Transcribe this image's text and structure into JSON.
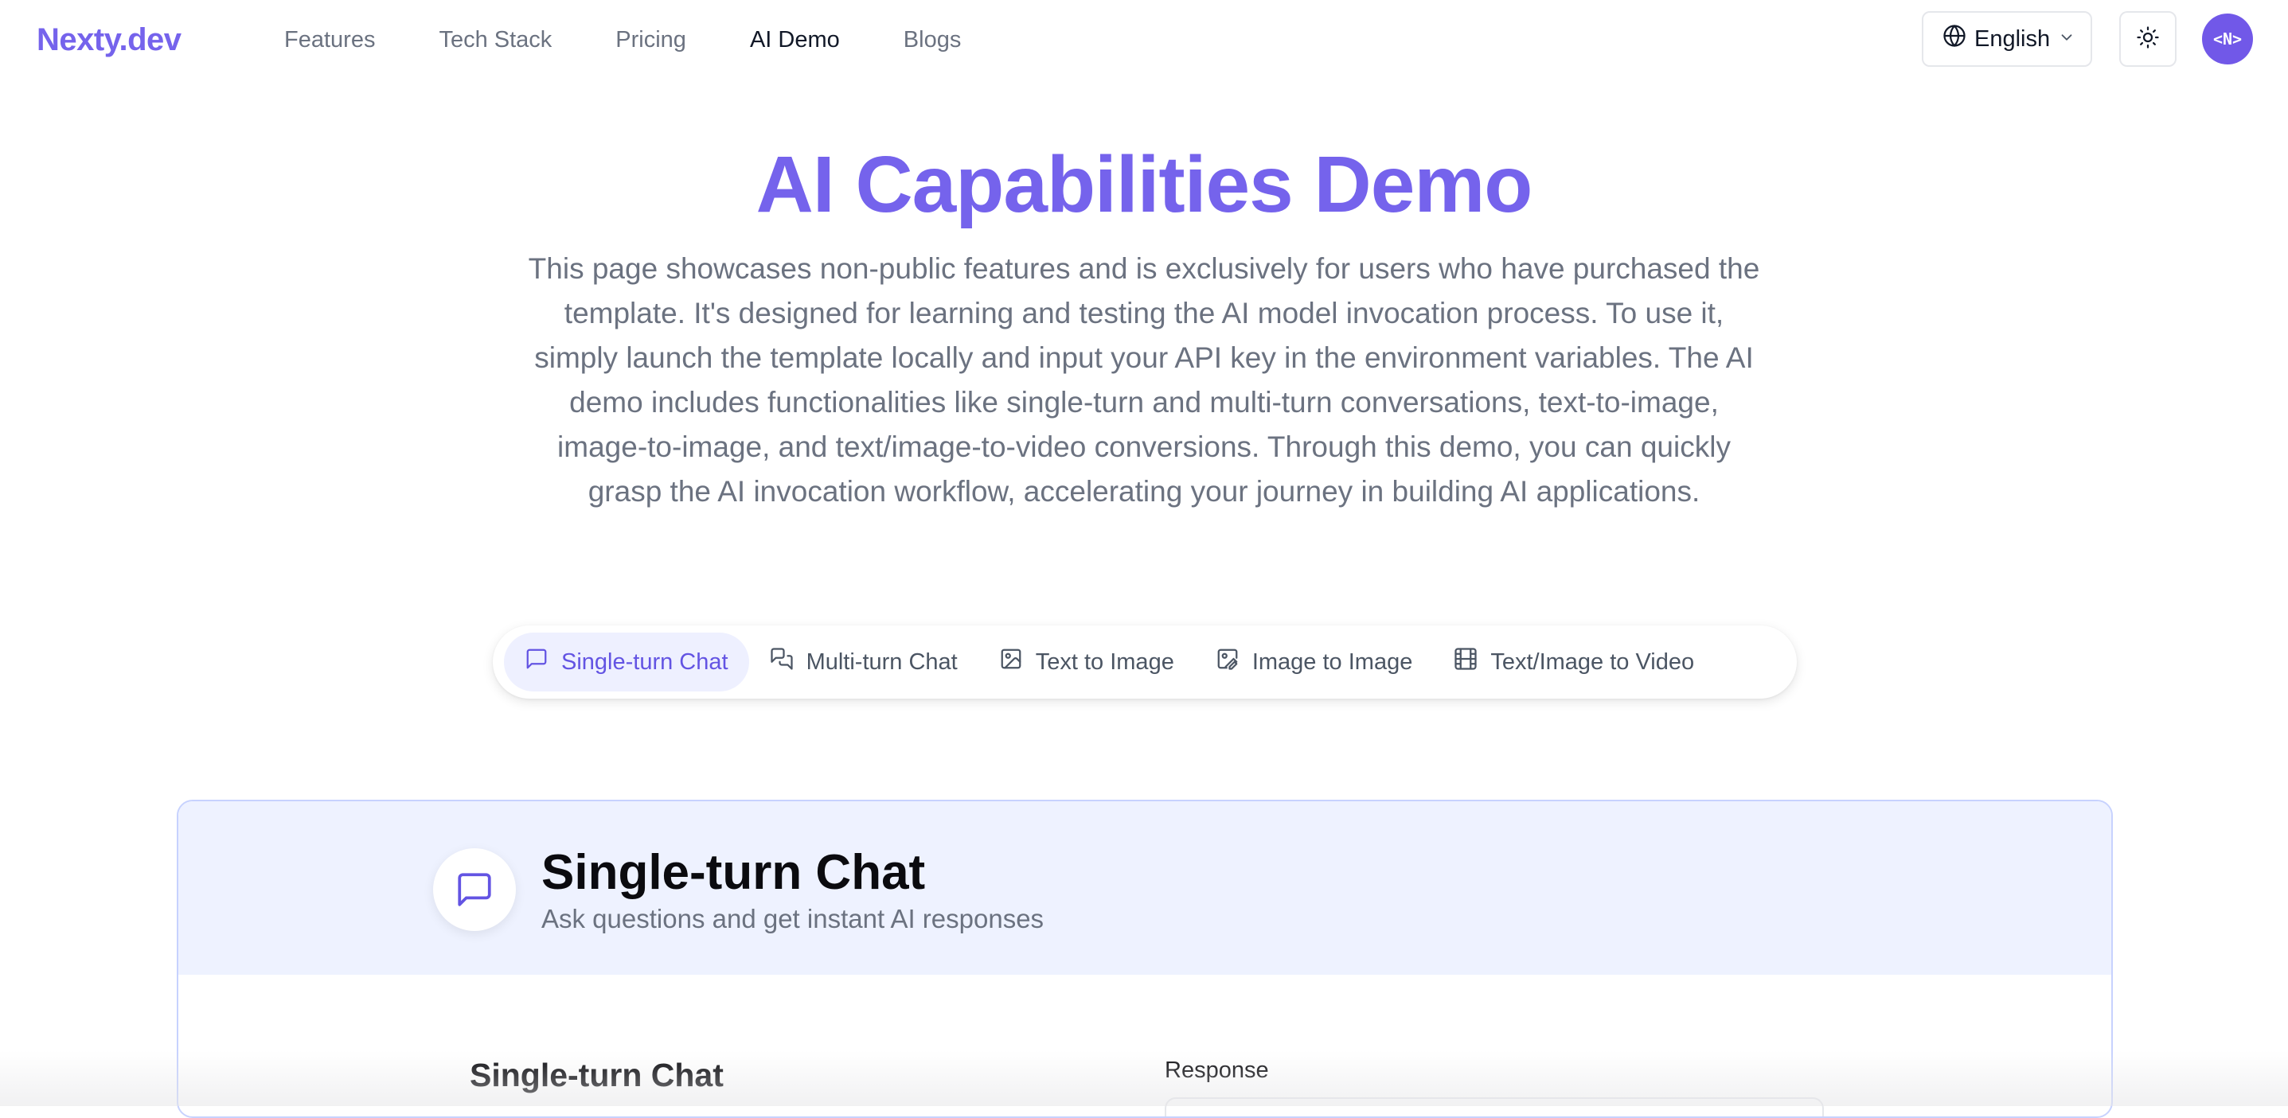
{
  "header": {
    "logo": "Nexty.dev",
    "nav": [
      {
        "label": "Features",
        "active": false
      },
      {
        "label": "Tech Stack",
        "active": false
      },
      {
        "label": "Pricing",
        "active": false
      },
      {
        "label": "AI Demo",
        "active": true
      },
      {
        "label": "Blogs",
        "active": false
      }
    ],
    "language": "English",
    "avatar_text": "<N>",
    "icons": {
      "language": "globe-icon",
      "language_dropdown": "chevron-down-icon",
      "theme": "sun-icon"
    }
  },
  "hero": {
    "title": "AI Capabilities Demo",
    "description": "This page showcases non-public features and is exclusively for users who have purchased the template. It's designed for learning and testing the AI model invocation process. To use it, simply launch the template locally and input your API key in the environment variables. The AI demo includes functionalities like single-turn and multi-turn conversations, text-to-image, image-to-image, and text/image-to-video conversions. Through this demo, you can quickly grasp the AI invocation workflow, accelerating your journey in building AI applications."
  },
  "tabs": [
    {
      "label": "Single-turn Chat",
      "icon": "message-square-icon",
      "active": true
    },
    {
      "label": "Multi-turn Chat",
      "icon": "messages-icon",
      "active": false
    },
    {
      "label": "Text to Image",
      "icon": "image-icon",
      "active": false
    },
    {
      "label": "Image to Image",
      "icon": "image-edit-icon",
      "active": false
    },
    {
      "label": "Text/Image to Video",
      "icon": "film-icon",
      "active": false
    }
  ],
  "demo": {
    "title": "Single-turn Chat",
    "subtitle": "Ask questions and get instant AI responses",
    "icon": "message-square-icon",
    "panel_title": "Single-turn Chat",
    "response_label": "Response"
  },
  "colors": {
    "brand": "#7563ec",
    "active_tab_bg": "#eef0ff",
    "card_header_bg": "#eef2ff",
    "card_border": "#c7d2fe"
  }
}
